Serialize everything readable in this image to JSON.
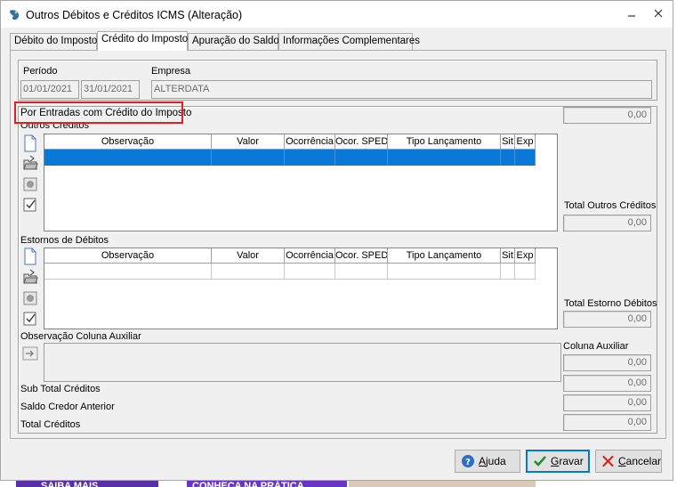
{
  "window": {
    "title": "Outros Débitos e Créditos ICMS (Alteração)"
  },
  "tabs": [
    {
      "label": "Débito do Imposto"
    },
    {
      "label": "Crédito do Imposto"
    },
    {
      "label": "Apuração do Saldo"
    },
    {
      "label": "Informações Complementares"
    }
  ],
  "header": {
    "periodo_label": "Período",
    "periodo_inicio": "01/01/2021",
    "periodo_fim": "31/01/2021",
    "empresa_label": "Empresa",
    "empresa_value": "ALTERDATA"
  },
  "section": {
    "title": "Por Entradas com Crédito do Imposto",
    "total_value": "0,00"
  },
  "grid_columns": [
    "Observação",
    "Valor",
    "Ocorrência",
    "Ocor. SPED",
    "Tipo Lançamento",
    "Sit",
    "Exp"
  ],
  "outros_creditos": {
    "label": "Outros Créditos",
    "total_label": "Total Outros Créditos",
    "total_value": "0,00"
  },
  "estornos_debitos": {
    "label": "Estornos de Débitos",
    "total_label": "Total Estorno Débitos",
    "total_value": "0,00"
  },
  "observacao": {
    "label": "Observação Coluna Auxiliar",
    "coluna_label": "Coluna Auxiliar",
    "coluna_value": "0,00"
  },
  "totals": {
    "sub_total_label": "Sub Total Créditos",
    "sub_total_value": "0,00",
    "saldo_credor_label": "Saldo Credor Anterior",
    "saldo_credor_value": "0,00",
    "total_label": "Total Créditos",
    "total_value": "0,00"
  },
  "buttons": {
    "ajuda": "Ajuda",
    "gravar": "Gravar",
    "cancelar": "Cancelar"
  },
  "background": {
    "strip_left": "SAIBA MAIS",
    "strip_right": "CONHEÇA NA PRÁTICA"
  },
  "colors": {
    "selection": "#0a78d7",
    "highlight": "#e02020",
    "accent": "#0078d7"
  }
}
